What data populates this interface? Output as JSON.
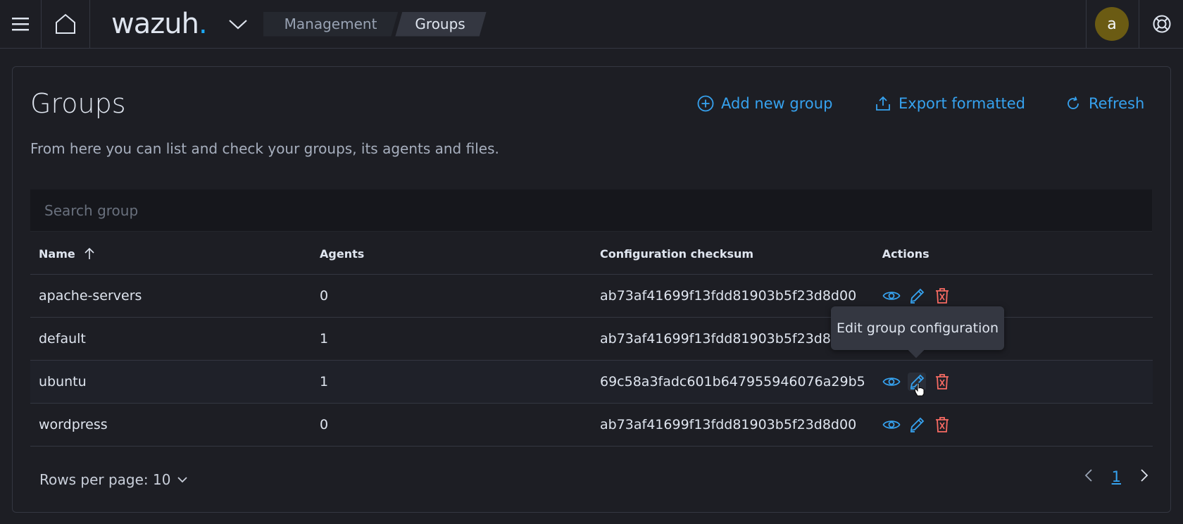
{
  "header": {
    "logo_text": "wazuh",
    "logo_dot": ".",
    "breadcrumb": [
      "Management",
      "Groups"
    ],
    "avatar_letter": "a"
  },
  "page": {
    "title": "Groups",
    "description": "From here you can list and check your groups, its agents and files.",
    "actions": {
      "add": "Add new group",
      "export": "Export formatted",
      "refresh": "Refresh"
    }
  },
  "search": {
    "placeholder": "Search group"
  },
  "table": {
    "columns": [
      "Name",
      "Agents",
      "Configuration checksum",
      "Actions"
    ],
    "rows": [
      {
        "name": "apache-servers",
        "agents": "0",
        "checksum": "ab73af41699f13fdd81903b5f23d8d00"
      },
      {
        "name": "default",
        "agents": "1",
        "checksum": "ab73af41699f13fdd81903b5f23d8d00"
      },
      {
        "name": "ubuntu",
        "agents": "1",
        "checksum": "69c58a3fadc601b647955946076a29b5"
      },
      {
        "name": "wordpress",
        "agents": "0",
        "checksum": "ab73af41699f13fdd81903b5f23d8d00"
      }
    ]
  },
  "tooltip": {
    "text": "Edit group configuration"
  },
  "footer": {
    "rows_per_page": "Rows per page: 10",
    "current_page": "1"
  },
  "colors": {
    "accent": "#36a2ef",
    "danger": "#f86b63",
    "background": "#1d1e24"
  }
}
